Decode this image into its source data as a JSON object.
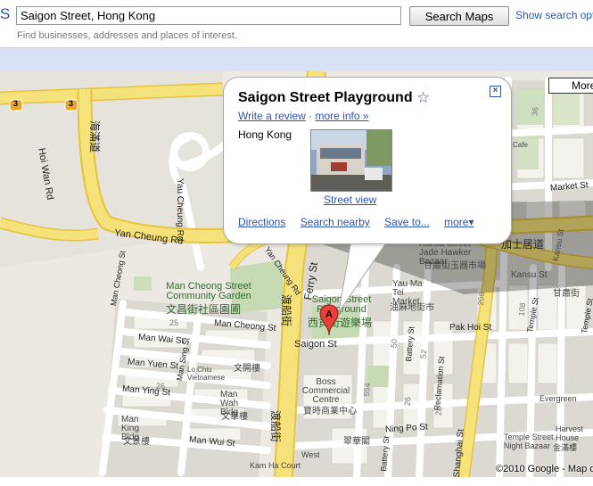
{
  "header": {
    "logo_fragment": "S",
    "search_value": "Saigon Street, Hong Kong",
    "search_button": "Search Maps",
    "show_options": "Show search opti",
    "hint": "Find businesses, addresses and places of interest."
  },
  "map_controls": {
    "more_label": "More"
  },
  "infowindow": {
    "title": "Saigon Street Playground",
    "write_review": "Write a review",
    "separator": "-",
    "more_info": "more info »",
    "address": "Hong Kong",
    "street_view": "Street view",
    "actions": [
      "Directions",
      "Search nearby",
      "Save to...",
      "more▾"
    ]
  },
  "map_labels": {
    "yan_cheung_rd": "Yan Cheung Rd",
    "yan_cheung_rd_b": "Yan Cheung Rd",
    "yau_cheung_rd": "Yau Cheung Rd",
    "hoi_wan_rd": "Hoi Wan Rd",
    "hoi_wan_cn": "海滿道",
    "ferry_st": "Ferry St",
    "ferry_st_cn": "渡船街",
    "ferry_st_cn_b": "渡船街",
    "man_cheong_garden": "Man Cheong Street Community Garden",
    "man_cheong_garden_cn": "文昌街社區園圃",
    "saigon_playground": "Saigon Street Playground",
    "saigon_playground_cn": "西貢街遊樂場",
    "saigon_st": "Saigon St",
    "man_cheong_st": "Man Cheong St",
    "man_cheong_st_b": "Man Cheong St",
    "man_wai_st": "Man Wai St",
    "man_yuen_st": "Man Yuen St",
    "man_ying_st": "Man Ying St",
    "man_sing_st": "Man Sing St",
    "man_wui_st": "Man Wui St",
    "lo_chiu": "Lo Chiu Vietnamese",
    "man_wah_bldg": "Man Wah Bldg",
    "man_wah_cn": "文華樓",
    "man_king_bldg": "Man King Bldg",
    "man_king_cn": "文景樓",
    "man_kai_cn": "文開樓",
    "boss_centre": "Boss Commercial Centre",
    "boss_centre_cn": "寶時商業中心",
    "yau_ma_tei_market": "Yau Ma Tei Market",
    "yau_ma_tei_market_cn": "油麻地街市",
    "kansu_st": "Kansu St",
    "kansu_st_b": "Kansu St",
    "kansu_cn": "甘肅街",
    "canal_rd_cn": "加士居道",
    "kansu_bazaar": "Kansu Street Jade Hawker Bazaar",
    "kansu_bazaar_cn": "甘肅街玉器市場",
    "market_st": "Market St",
    "pak_hoi_st": "Pak Hoi St",
    "battery_st": "Battery St",
    "battery_st_b": "Battery St",
    "reclamation_st": "Reclamation St",
    "temple_st": "Temple St",
    "temple_st_b": "Temple St",
    "temple_bazaar": "Temple Street Night Bazaar",
    "evergreen": "Evergreen",
    "harvest_house": "Harvest House",
    "harvest_cn": "金滿樓",
    "ning_po_st": "Ning Po St",
    "shanghai_st": "Shanghai St",
    "kam_ha": "Kam Ha Court",
    "west": "West",
    "cafe": "Cafe",
    "cuihua_cn": "翠華閣",
    "route_3a": "3",
    "route_3b": "3",
    "n25": "25",
    "n26": "26",
    "n50": "50",
    "n52": "52",
    "n28": "28",
    "n26b": "26",
    "n208": "208",
    "n108": "108",
    "n554": "554",
    "n36": "36"
  },
  "marker": {
    "letter": "A"
  },
  "copyright": "©2010 Google - Map d",
  "colors": {
    "major_road": "#f6e27a",
    "road_edge": "#e5c33e",
    "park": "#c6dbb3",
    "block": "#dcd9d2",
    "building": "#f4f2ec",
    "link": "#2c53b3"
  }
}
